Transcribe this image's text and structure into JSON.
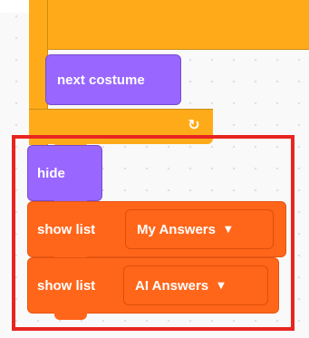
{
  "blocks": {
    "next_costume": {
      "label": "next costume",
      "category": "looks",
      "color": "#9966ff"
    },
    "hide": {
      "label": "hide",
      "category": "looks",
      "color": "#9966ff"
    },
    "show_list_1": {
      "label": "show list",
      "dropdown": "My Answers",
      "category": "variables-list",
      "color": "#ff661a"
    },
    "show_list_2": {
      "label": "show list",
      "dropdown": "AI Answers",
      "category": "variables-list",
      "color": "#ff661a"
    }
  },
  "control_block": {
    "color": "#ffab19",
    "icon": "repeat-arrow-icon",
    "glyph": "↻"
  },
  "highlight": {
    "color": "#e8251f"
  },
  "icons": {
    "dropdown_caret": "▼"
  }
}
